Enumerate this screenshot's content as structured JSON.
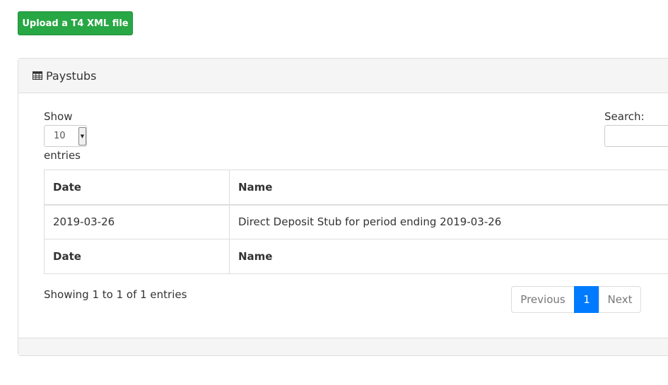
{
  "toolbar": {
    "upload_label": "Upload a T4 XML file"
  },
  "panel": {
    "title": "Paystubs",
    "title_icon": "table-icon"
  },
  "controls": {
    "show_label": "Show",
    "length_value": "10",
    "entries_label": "entries",
    "search_label": "Search:",
    "search_value": ""
  },
  "table": {
    "headers": [
      "Date",
      "Name"
    ],
    "rows": [
      [
        "2019-03-26",
        "Direct Deposit Stub for period ending 2019-03-26"
      ]
    ],
    "footers": [
      "Date",
      "Name"
    ]
  },
  "info": "Showing 1 to 1 of 1 entries",
  "pagination": {
    "previous": "Previous",
    "current": "1",
    "next": "Next"
  },
  "colors": {
    "upload_button": "#28a745",
    "active_page": "#007bff"
  }
}
